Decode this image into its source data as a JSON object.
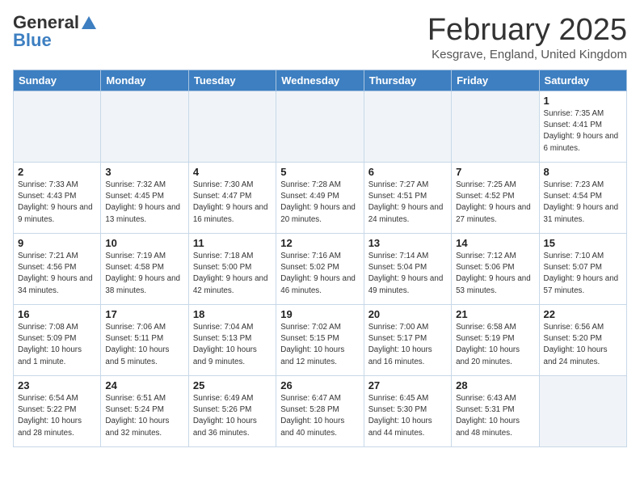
{
  "header": {
    "logo_line1": "General",
    "logo_line2": "Blue",
    "month": "February 2025",
    "location": "Kesgrave, England, United Kingdom"
  },
  "days_of_week": [
    "Sunday",
    "Monday",
    "Tuesday",
    "Wednesday",
    "Thursday",
    "Friday",
    "Saturday"
  ],
  "weeks": [
    [
      {
        "day": "",
        "info": ""
      },
      {
        "day": "",
        "info": ""
      },
      {
        "day": "",
        "info": ""
      },
      {
        "day": "",
        "info": ""
      },
      {
        "day": "",
        "info": ""
      },
      {
        "day": "",
        "info": ""
      },
      {
        "day": "1",
        "info": "Sunrise: 7:35 AM\nSunset: 4:41 PM\nDaylight: 9 hours and 6 minutes."
      }
    ],
    [
      {
        "day": "2",
        "info": "Sunrise: 7:33 AM\nSunset: 4:43 PM\nDaylight: 9 hours and 9 minutes."
      },
      {
        "day": "3",
        "info": "Sunrise: 7:32 AM\nSunset: 4:45 PM\nDaylight: 9 hours and 13 minutes."
      },
      {
        "day": "4",
        "info": "Sunrise: 7:30 AM\nSunset: 4:47 PM\nDaylight: 9 hours and 16 minutes."
      },
      {
        "day": "5",
        "info": "Sunrise: 7:28 AM\nSunset: 4:49 PM\nDaylight: 9 hours and 20 minutes."
      },
      {
        "day": "6",
        "info": "Sunrise: 7:27 AM\nSunset: 4:51 PM\nDaylight: 9 hours and 24 minutes."
      },
      {
        "day": "7",
        "info": "Sunrise: 7:25 AM\nSunset: 4:52 PM\nDaylight: 9 hours and 27 minutes."
      },
      {
        "day": "8",
        "info": "Sunrise: 7:23 AM\nSunset: 4:54 PM\nDaylight: 9 hours and 31 minutes."
      }
    ],
    [
      {
        "day": "9",
        "info": "Sunrise: 7:21 AM\nSunset: 4:56 PM\nDaylight: 9 hours and 34 minutes."
      },
      {
        "day": "10",
        "info": "Sunrise: 7:19 AM\nSunset: 4:58 PM\nDaylight: 9 hours and 38 minutes."
      },
      {
        "day": "11",
        "info": "Sunrise: 7:18 AM\nSunset: 5:00 PM\nDaylight: 9 hours and 42 minutes."
      },
      {
        "day": "12",
        "info": "Sunrise: 7:16 AM\nSunset: 5:02 PM\nDaylight: 9 hours and 46 minutes."
      },
      {
        "day": "13",
        "info": "Sunrise: 7:14 AM\nSunset: 5:04 PM\nDaylight: 9 hours and 49 minutes."
      },
      {
        "day": "14",
        "info": "Sunrise: 7:12 AM\nSunset: 5:06 PM\nDaylight: 9 hours and 53 minutes."
      },
      {
        "day": "15",
        "info": "Sunrise: 7:10 AM\nSunset: 5:07 PM\nDaylight: 9 hours and 57 minutes."
      }
    ],
    [
      {
        "day": "16",
        "info": "Sunrise: 7:08 AM\nSunset: 5:09 PM\nDaylight: 10 hours and 1 minute."
      },
      {
        "day": "17",
        "info": "Sunrise: 7:06 AM\nSunset: 5:11 PM\nDaylight: 10 hours and 5 minutes."
      },
      {
        "day": "18",
        "info": "Sunrise: 7:04 AM\nSunset: 5:13 PM\nDaylight: 10 hours and 9 minutes."
      },
      {
        "day": "19",
        "info": "Sunrise: 7:02 AM\nSunset: 5:15 PM\nDaylight: 10 hours and 12 minutes."
      },
      {
        "day": "20",
        "info": "Sunrise: 7:00 AM\nSunset: 5:17 PM\nDaylight: 10 hours and 16 minutes."
      },
      {
        "day": "21",
        "info": "Sunrise: 6:58 AM\nSunset: 5:19 PM\nDaylight: 10 hours and 20 minutes."
      },
      {
        "day": "22",
        "info": "Sunrise: 6:56 AM\nSunset: 5:20 PM\nDaylight: 10 hours and 24 minutes."
      }
    ],
    [
      {
        "day": "23",
        "info": "Sunrise: 6:54 AM\nSunset: 5:22 PM\nDaylight: 10 hours and 28 minutes."
      },
      {
        "day": "24",
        "info": "Sunrise: 6:51 AM\nSunset: 5:24 PM\nDaylight: 10 hours and 32 minutes."
      },
      {
        "day": "25",
        "info": "Sunrise: 6:49 AM\nSunset: 5:26 PM\nDaylight: 10 hours and 36 minutes."
      },
      {
        "day": "26",
        "info": "Sunrise: 6:47 AM\nSunset: 5:28 PM\nDaylight: 10 hours and 40 minutes."
      },
      {
        "day": "27",
        "info": "Sunrise: 6:45 AM\nSunset: 5:30 PM\nDaylight: 10 hours and 44 minutes."
      },
      {
        "day": "28",
        "info": "Sunrise: 6:43 AM\nSunset: 5:31 PM\nDaylight: 10 hours and 48 minutes."
      },
      {
        "day": "",
        "info": ""
      }
    ]
  ]
}
